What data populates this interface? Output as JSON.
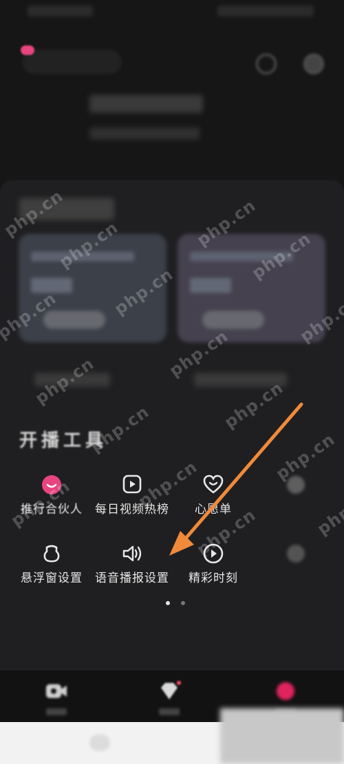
{
  "section": {
    "title": "开播工具"
  },
  "tools": [
    {
      "label": "推行合伙人",
      "icon": "partner-avatar-icon"
    },
    {
      "label": "每日视频热榜",
      "icon": "play-square-icon"
    },
    {
      "label": "心愿单",
      "icon": "heart-icon"
    },
    {
      "label": "",
      "icon": "blurred-tool-icon"
    },
    {
      "label": "悬浮窗设置",
      "icon": "floating-window-icon"
    },
    {
      "label": "语音播报设置",
      "icon": "speaker-icon"
    },
    {
      "label": "精彩时刻",
      "icon": "play-circle-icon"
    },
    {
      "label": "",
      "icon": "blurred-tool-icon"
    }
  ],
  "pager": {
    "pages": 2,
    "current": 1
  },
  "watermark": "php.cn",
  "colors": {
    "background": "#161616",
    "panel": "#1f1f21",
    "arrow": "#f08a3a",
    "tab_active": "#ff2d55",
    "tool_icon": "#e8e8e8"
  }
}
